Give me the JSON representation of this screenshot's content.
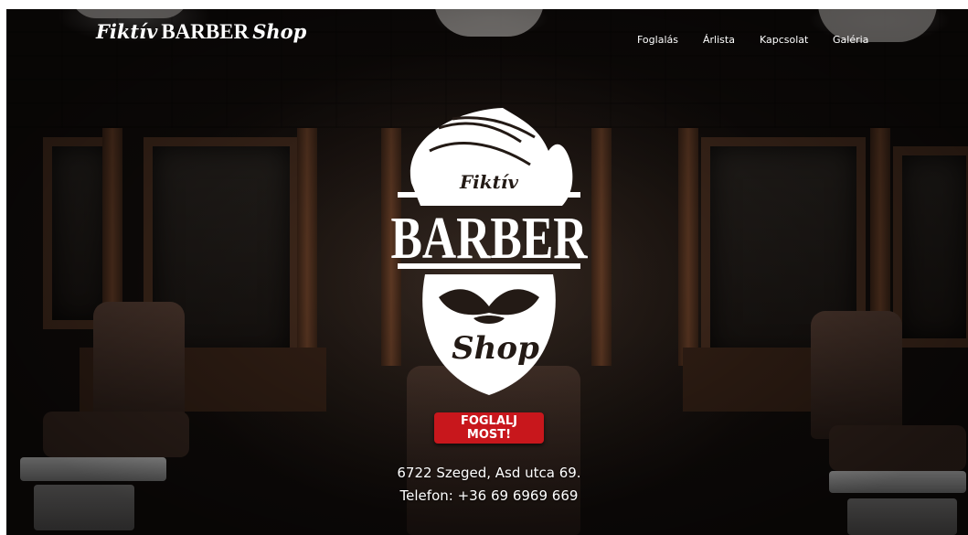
{
  "brand": {
    "script": "Fiktív",
    "block": "BARBER",
    "script2": "Shop"
  },
  "nav": {
    "items": [
      {
        "label": "Foglalás"
      },
      {
        "label": "Árlista"
      },
      {
        "label": "Kapcsolat"
      },
      {
        "label": "Galéria"
      }
    ]
  },
  "logo": {
    "script_top": "Fiktív",
    "main": "BARBER",
    "script_bottom": "Shop"
  },
  "cta": {
    "label": "FOGLALJ MOST!"
  },
  "contact": {
    "address": "6722 Szeged, Asd utca 69.",
    "phone": "Telefon: +36 69 6969 669"
  },
  "colors": {
    "accent": "#c8171c",
    "text": "#ffffff"
  }
}
